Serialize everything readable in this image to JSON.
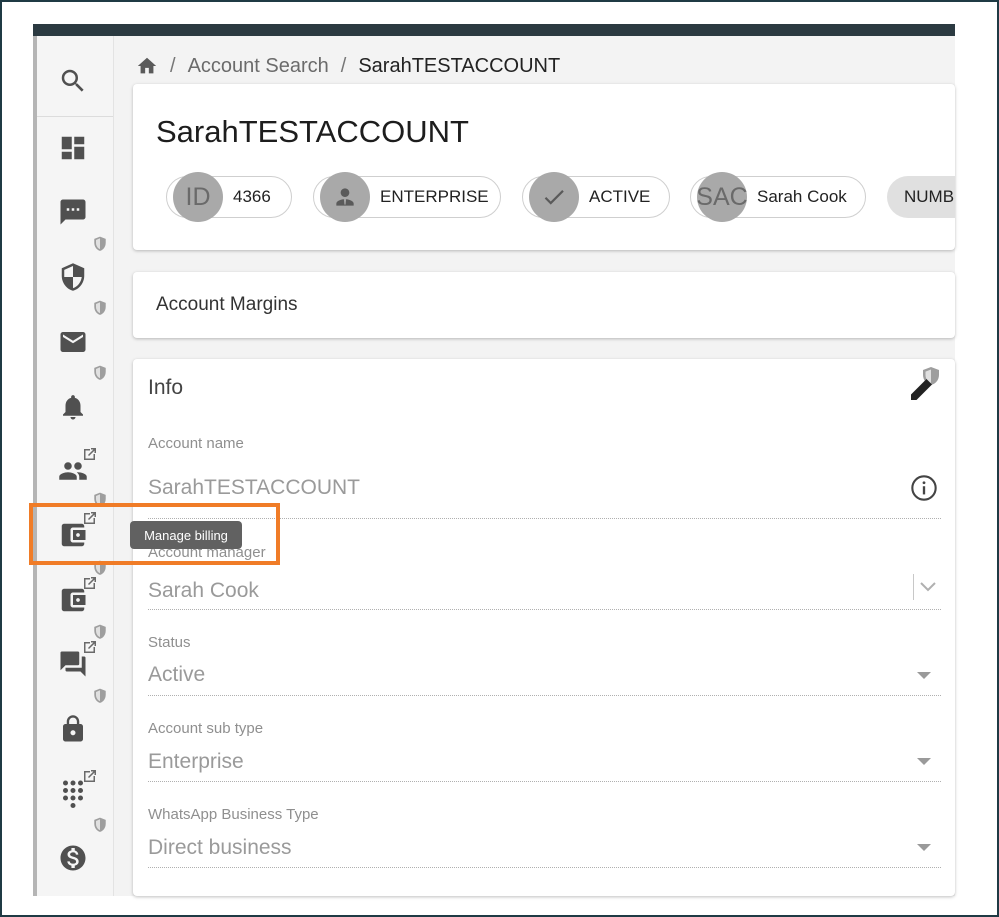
{
  "breadcrumb": {
    "home_icon": "home-icon",
    "items": [
      "Account Search",
      "SarahTESTACCOUNT"
    ],
    "separator": "/"
  },
  "account": {
    "title": "SarahTESTACCOUNT",
    "chips": [
      {
        "avatar_text": "ID",
        "label": "4366"
      },
      {
        "avatar_icon": "person-icon",
        "label": "ENTERPRISE"
      },
      {
        "avatar_icon": "check-icon",
        "label": "ACTIVE"
      },
      {
        "avatar_text": "SAC",
        "label": "Sarah Cook"
      }
    ],
    "extra_chip": "NUMB"
  },
  "margins": {
    "title": "Account Margins"
  },
  "info": {
    "title": "Info",
    "fields": {
      "account_name": {
        "label": "Account name",
        "value": "SarahTESTACCOUNT"
      },
      "account_manager": {
        "label": "Account manager",
        "value": "Sarah Cook"
      },
      "status": {
        "label": "Status",
        "value": "Active"
      },
      "sub_type": {
        "label": "Account sub type",
        "value": "Enterprise"
      },
      "whatsapp_type": {
        "label": "WhatsApp Business Type",
        "value": "Direct business"
      }
    }
  },
  "sidebar": {
    "items": [
      {
        "icon": "search-icon"
      },
      {
        "icon": "dashboard-icon"
      },
      {
        "icon": "message-icon"
      },
      {
        "icon": "shield-icon"
      },
      {
        "icon": "mail-icon"
      },
      {
        "icon": "bell-icon"
      },
      {
        "icon": "users-icon"
      },
      {
        "icon": "wallet-icon"
      },
      {
        "icon": "wallet-icon"
      },
      {
        "icon": "chat-icon"
      },
      {
        "icon": "lock-icon"
      },
      {
        "icon": "dialpad-icon"
      },
      {
        "icon": "dollar-icon"
      }
    ],
    "tooltip": "Manage billing"
  },
  "colors": {
    "highlight": "#f07c27",
    "topbar": "#2b3a41",
    "tooltip_bg": "#616161"
  }
}
